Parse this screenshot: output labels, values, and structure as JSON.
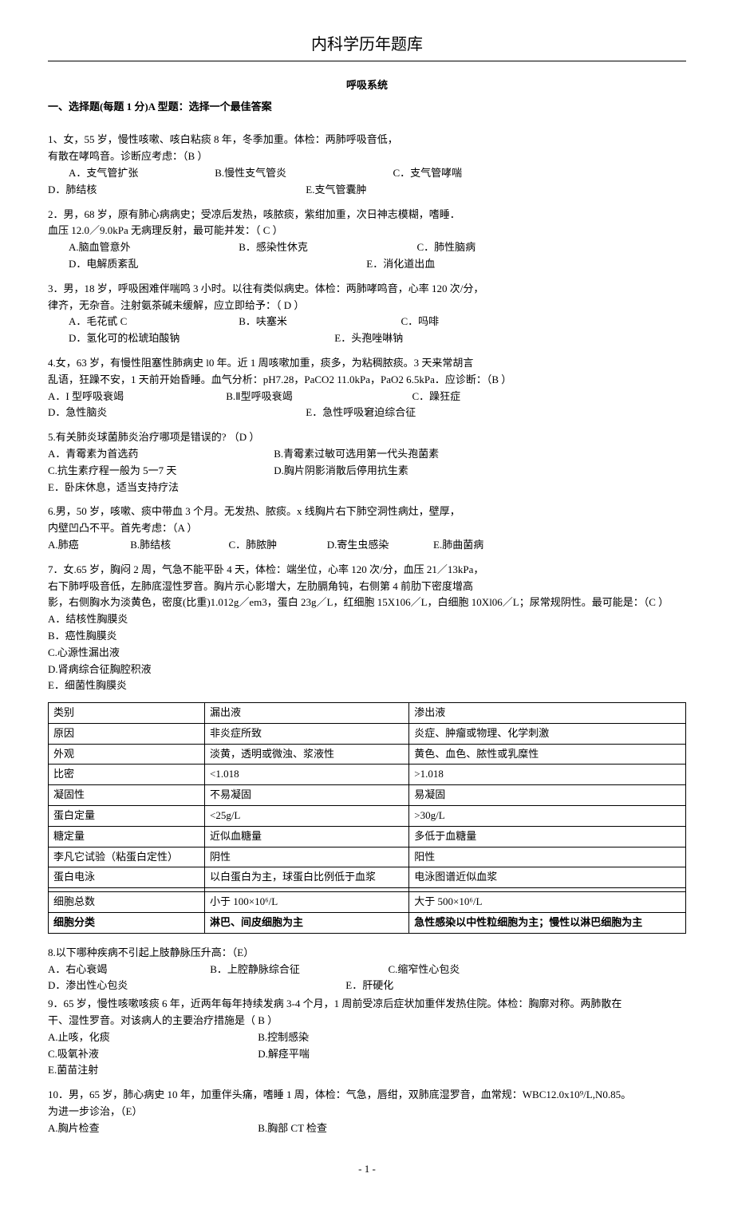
{
  "page_title": "内科学历年题库",
  "sub_title": "呼吸系统",
  "section_heading": "一、选择题(每题 1 分)A 型题：选择一个最佳答案",
  "q1": {
    "stem1": "1、女，55 岁，慢性咳嗽、咳白粘痰 8 年，冬季加重。体检：两肺呼吸音低，",
    "stem2": "有散在哮鸣音。诊断应考虑：（B ）",
    "optA": "A．支气管扩张",
    "optB": "B.慢性支气管炎",
    "optC": "C．支气管哮喘",
    "optD": "D．肺结核",
    "optE": "E.支气管囊肿"
  },
  "q2": {
    "stem1": "2．男，68 岁，原有肺心病病史；受凉后发热，咳脓痰，紫绀加重，次日神志模糊，嗜睡．",
    "stem2": "血压 12.0／9.0kPa 无病理反射，最可能并发：（ C ）",
    "optA": "A.脑血管意外",
    "optB": "B．感染性休克",
    "optC": "C．肺性脑病",
    "optD": "D．电解质紊乱",
    "optE": "E．消化道出血"
  },
  "q3": {
    "stem1": "3．男，18 岁，呼吸困难伴喘鸣 3 小时。以往有类似病史。体检：两肺哮鸣音，心率 120 次/分，",
    "stem2": "律齐，无杂音。注射氨茶碱未缓解，应立即给予：（ D ）",
    "optA": "A．毛花甙 C",
    "optB": "B．呋塞米",
    "optC": "C．吗啡",
    "optD": "D．氢化可的松琥珀酸钠",
    "optE": "E．头孢唑啉钠"
  },
  "q4": {
    "stem1": "4.女，63 岁，有慢性阻塞性肺病史 l0 年。近 1 周咳嗽加重，痰多，为粘稠脓痰。3 天来常胡言",
    "stem2": "乱语，狂躁不安，1 天前开始昏睡。血气分析：pH7.28，PaCO2 11.0kPa，PaO2 6.5kPa．应诊断：（B ）",
    "optA": "A．I 型呼吸衰竭",
    "optB": "B.Ⅱ型呼吸衰竭",
    "optC": "C．躁狂症",
    "optD": "D．急性脑炎",
    "optE": "E．急性呼吸窘迫综合征"
  },
  "q5": {
    "stem": "5.有关肺炎球菌肺炎治疗哪项是错误的?     （D ）",
    "optA": "A．青霉素为首选药",
    "optB": "B.青霉素过敏可选用第一代头孢菌素",
    "optC": "C.抗生素疗程一般为 5一7 天",
    "optD": "D.胸片阴影消散后停用抗生素",
    "optE": "E．卧床休息，适当支持疗法"
  },
  "q6": {
    "stem1": "6.男，50 岁，咳嗽、痰中带血 3 个月。无发热、脓痰。x 线胸片右下肺空洞性病灶，壁厚，",
    "stem2": "内壁凹凸不平。首先考虑：（A ）",
    "optA": "A.肺癌",
    "optB": "B.肺结核",
    "optC": "C．肺脓肿",
    "optD": "D.寄生虫感染",
    "optE": "E.肺曲菌病"
  },
  "q7": {
    "stem1": "7．女.65 岁，胸闷 2 周，气急不能平卧 4 天，体检：端坐位，心率 120 次/分，血压 21／13kPa，",
    "stem2": "右下肺呼吸音低，左肺底湿性罗音。胸片示心影增大，左肋膈角钝，右侧第 4 前肋下密度增高",
    "stem3": "影，右侧胸水为淡黄色，密度(比重)1.012g／em3，蛋白 23g／L，红细胞 15X106／L，白细胞 10Xl06／L；尿常规阴性。最可能是：（C ）",
    "optA": "A．结核性胸膜炎",
    "optB": "B．癌性胸膜炎",
    "optC": "C.心源性漏出液",
    "optD": "D.肾病综合征胸腔积液",
    "optE": "E．细菌性胸膜炎"
  },
  "table": {
    "headers": [
      "类别",
      "漏出液",
      "渗出液"
    ],
    "rows": [
      [
        "原因",
        "非炎症所致",
        "炎症、肿瘤或物理、化学刺激"
      ],
      [
        "外观",
        "淡黄，透明或微浊、浆液性",
        "黄色、血色、脓性或乳糜性"
      ],
      [
        "比密",
        "<1.018",
        ">1.018"
      ],
      [
        "凝固性",
        "不易凝固",
        "易凝固"
      ],
      [
        "蛋白定量",
        "<25g/L",
        ">30g/L"
      ],
      [
        "糖定量",
        "近似血糖量",
        "多低于血糖量"
      ],
      [
        "李凡它试验（粘蛋白定性）",
        "阴性",
        "阳性"
      ],
      [
        "蛋白电泳",
        "以白蛋白为主，球蛋白比例低于血浆",
        "电泳图谱近似血浆"
      ],
      [
        "",
        "",
        ""
      ],
      [
        "细胞总数",
        "小于 100×10⁶/L",
        "大于 500×10⁶/L"
      ]
    ],
    "bold_row": [
      "细胞分类",
      "淋巴、间皮细胞为主",
      "急性感染以中性粒细胞为主；慢性以淋巴细胞为主"
    ]
  },
  "q8": {
    "stem": "8.以下哪种疾病不引起上肢静脉压升高：（E）",
    "optA": "A．右心衰竭",
    "optB": "B．上腔静脉综合征",
    "optC": "C.缩窄性心包炎",
    "optD": "D．渗出性心包炎",
    "optE": "E．肝硬化"
  },
  "q9": {
    "stem1": "9．65 岁，慢性咳嗽咳痰 6 年，近两年每年持续发病 3-4 个月，1 周前受凉后症状加重伴发热住院。体检：胸廓对称。两肺散在",
    "stem2": "干、湿性罗音。对该病人的主要治疗措施是（  B ）",
    "optA": "A.止咳，化痰",
    "optB": "B.控制感染",
    "optC": "C.吸氧补液",
    "optD": "D.解痉平喘",
    "optE": "E.菌苗注射"
  },
  "q10": {
    "stem1": "10．男，65 岁，肺心病史 10 年，加重伴头痛，嗜睡 1 周，体检：气急，唇绀，双肺底湿罗音，血常规：WBC12.0x10⁹/L,N0.85。",
    "stem2": "为进一步诊治，（E）",
    "optA": "A.胸片检查",
    "optB": "B.胸部 CT 检查"
  },
  "page_num": "- 1 -"
}
